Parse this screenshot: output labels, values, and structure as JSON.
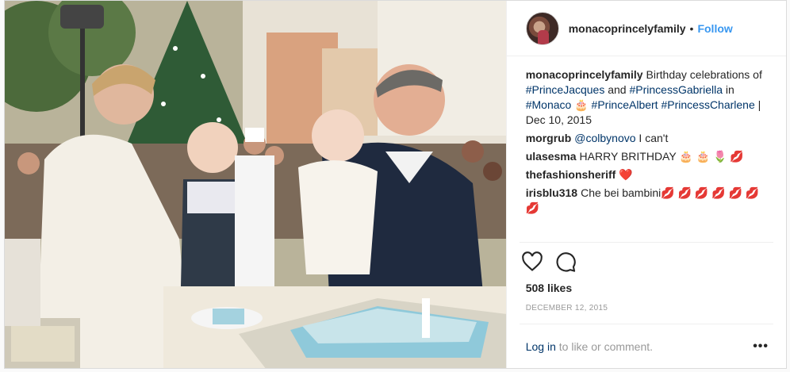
{
  "post": {
    "username": "monacoprincelyfamily",
    "separator": "•",
    "follow_label": "Follow",
    "caption": {
      "user": "monacoprincelyfamily",
      "parts": [
        {
          "t": "Birthday celebrations of ",
          "tag": false
        },
        {
          "t": "#PrinceJacques",
          "tag": true
        },
        {
          "t": " and ",
          "tag": false
        },
        {
          "t": "#PrincessGabriella",
          "tag": true
        },
        {
          "t": " in ",
          "tag": false
        },
        {
          "t": "#Monaco",
          "tag": true
        },
        {
          "t": " 🎂 ",
          "tag": false
        },
        {
          "t": "#PrinceAlbert",
          "tag": true
        },
        {
          "t": " ",
          "tag": false
        },
        {
          "t": "#PrincessCharlene",
          "tag": true
        },
        {
          "t": " | Dec 10, 2015",
          "tag": false
        }
      ]
    },
    "comments": [
      {
        "user": "morgrub",
        "mention": "@colbynovo",
        "text": " I can't"
      },
      {
        "user": "ulasesma",
        "mention": "",
        "text": "HARRY BRITHDAY 🎂 🎂 🌷 💋"
      },
      {
        "user": "thefashionsheriff",
        "mention": "",
        "text": "❤️"
      },
      {
        "user": "irisblu318",
        "mention": "",
        "text": "Che bei bambini💋 💋 💋 💋 💋 💋 💋"
      }
    ],
    "likes_label": "508 likes",
    "date_label": "DECEMBER 12, 2015",
    "login_link": "Log in",
    "login_text": " to like or comment.",
    "more_label": "•••"
  },
  "icons": {
    "heart": "heart-icon",
    "comment": "comment-icon",
    "more": "more-options-icon"
  },
  "colors": {
    "link": "#3897f0",
    "hashtag": "#003569",
    "muted": "#999999",
    "text": "#262626"
  }
}
